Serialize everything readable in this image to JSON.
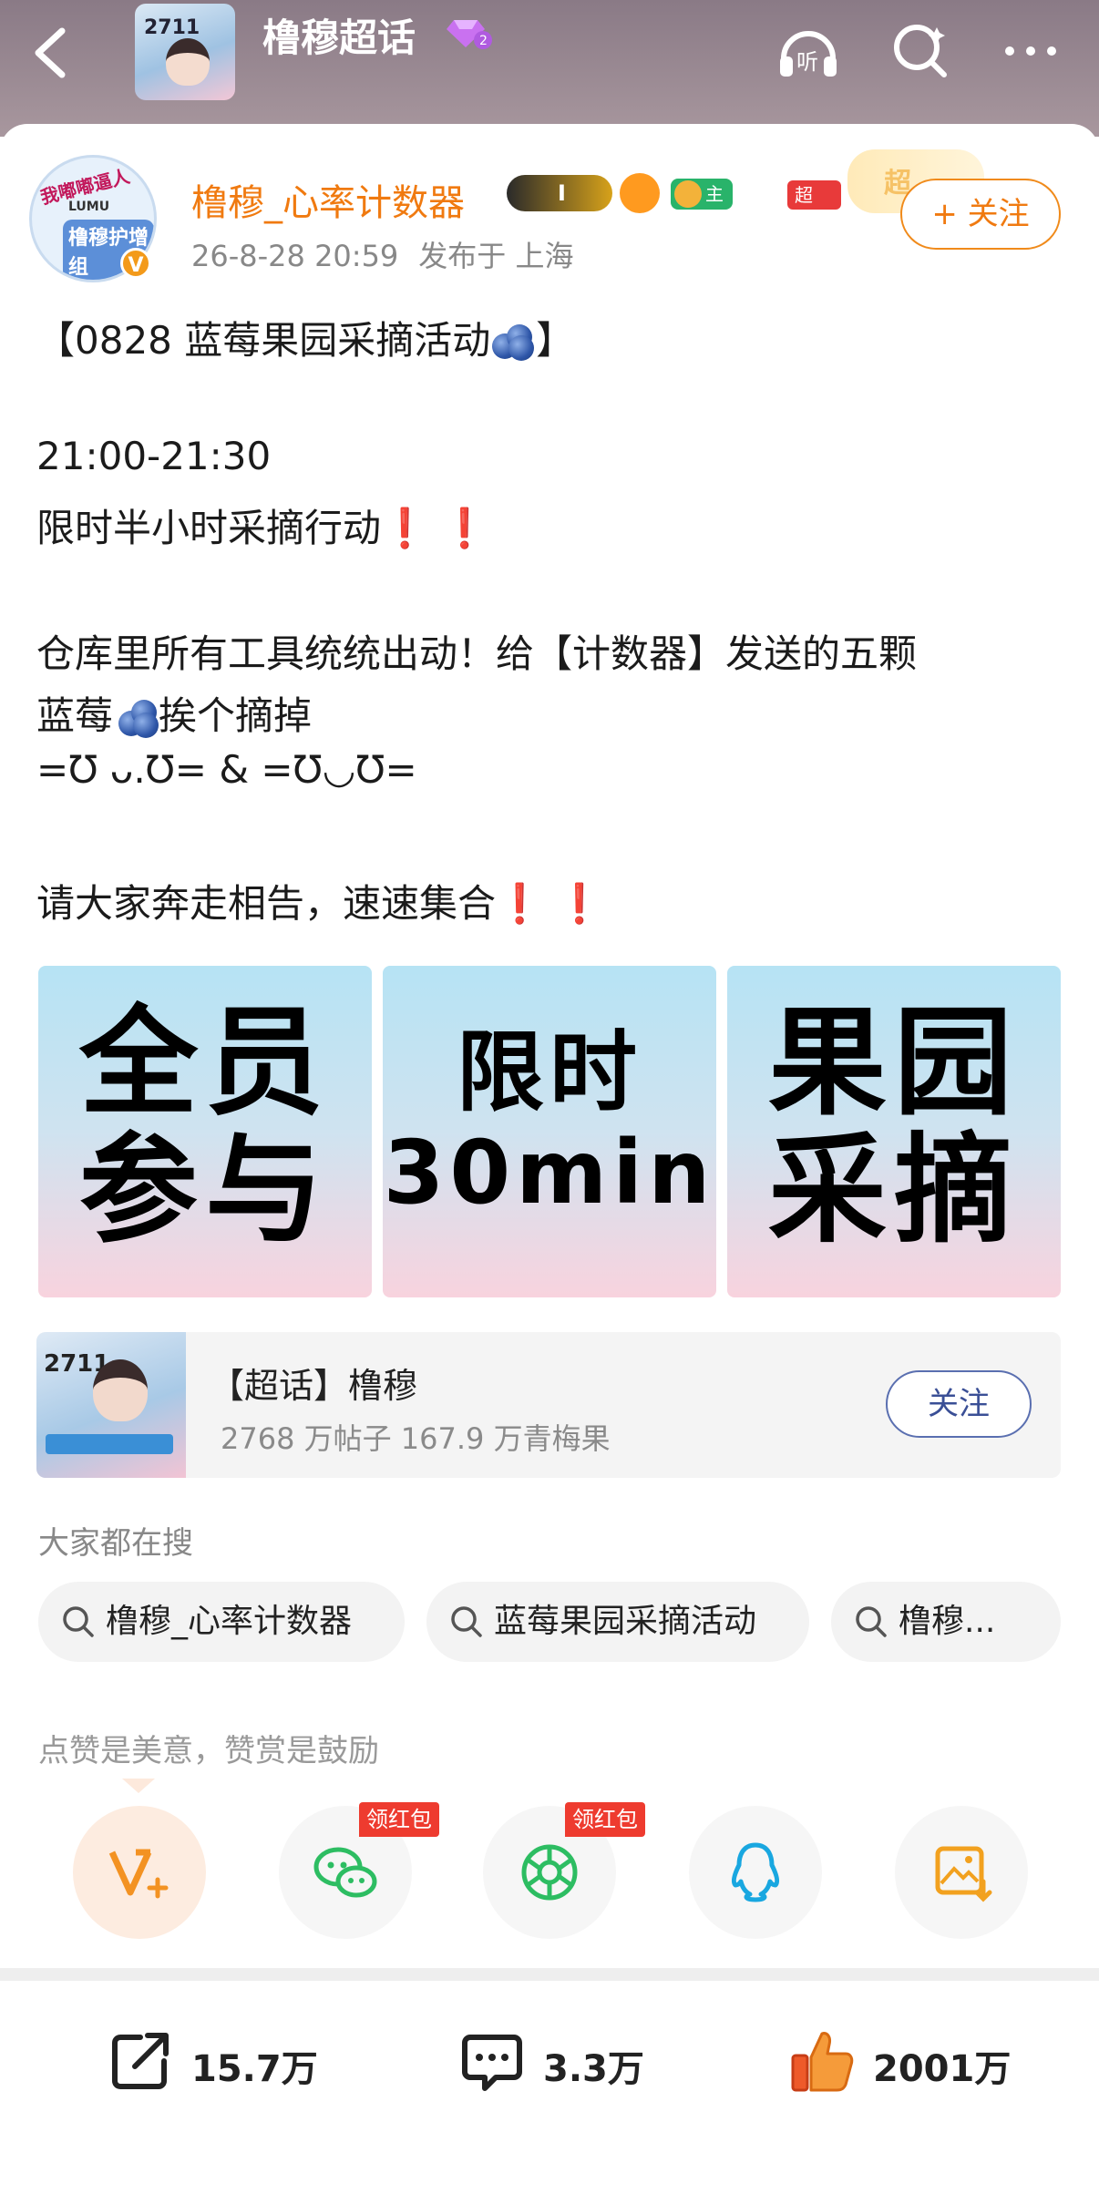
{
  "header": {
    "title": "橹穆超话",
    "avatar_text": "2711",
    "level_badge": "2"
  },
  "post": {
    "author": "橹穆_心率计数器",
    "avatar_text": {
      "line1": "我嘟嘟逼人",
      "line2": "LUMU",
      "line3": "橹穆护增组"
    },
    "time": "26-8-28 20:59",
    "location": "发布于 上海",
    "follow_label": "+ 关注",
    "badges": {
      "crown_level": "I",
      "host": "主持人",
      "super_like": "超LIKE",
      "deco": "超"
    },
    "lines": {
      "title": "【0828 蓝莓果园采摘活动",
      "title_end": "】",
      "time_range": "21:00-21:30",
      "limit": "限时半小时采摘行动",
      "tools1": "仓库里所有工具统统出动！给【计数器】发送的五颗",
      "tools2a": "蓝莓",
      "tools2b": "挨个摘掉",
      "faces": "=Ʊ ᴗ.Ʊ= & =Ʊ◡Ʊ=",
      "call": "请大家奔走相告，速速集合",
      "bang": "❗"
    },
    "images": [
      {
        "line1": "全员",
        "line2": "参与"
      },
      {
        "line1": "限时",
        "line2": "30min"
      },
      {
        "line1": "果园",
        "line2": "采摘"
      }
    ]
  },
  "topic": {
    "avatar_text": "2711",
    "title": "【超话】橹穆",
    "stats": "2768 万帖子 167.9 万青梅果",
    "follow_label": "关注"
  },
  "search": {
    "label": "大家都在搜",
    "chips": [
      "橹穆_心率计数器",
      "蓝莓果园采摘活动",
      "橹穆..."
    ]
  },
  "share": {
    "hint": "点赞是美意，赞赏是鼓励",
    "red_packet": "领红包",
    "icons": [
      "reward-icon",
      "wechat-icon",
      "moments-icon",
      "qq-icon",
      "save-image-icon"
    ]
  },
  "bottom": {
    "repost": "15.7万",
    "comment": "3.3万",
    "like": "2001万"
  },
  "colors": {
    "accent": "#f07a10",
    "topbar": "#9a8a94",
    "alert": "#e21b1b"
  }
}
